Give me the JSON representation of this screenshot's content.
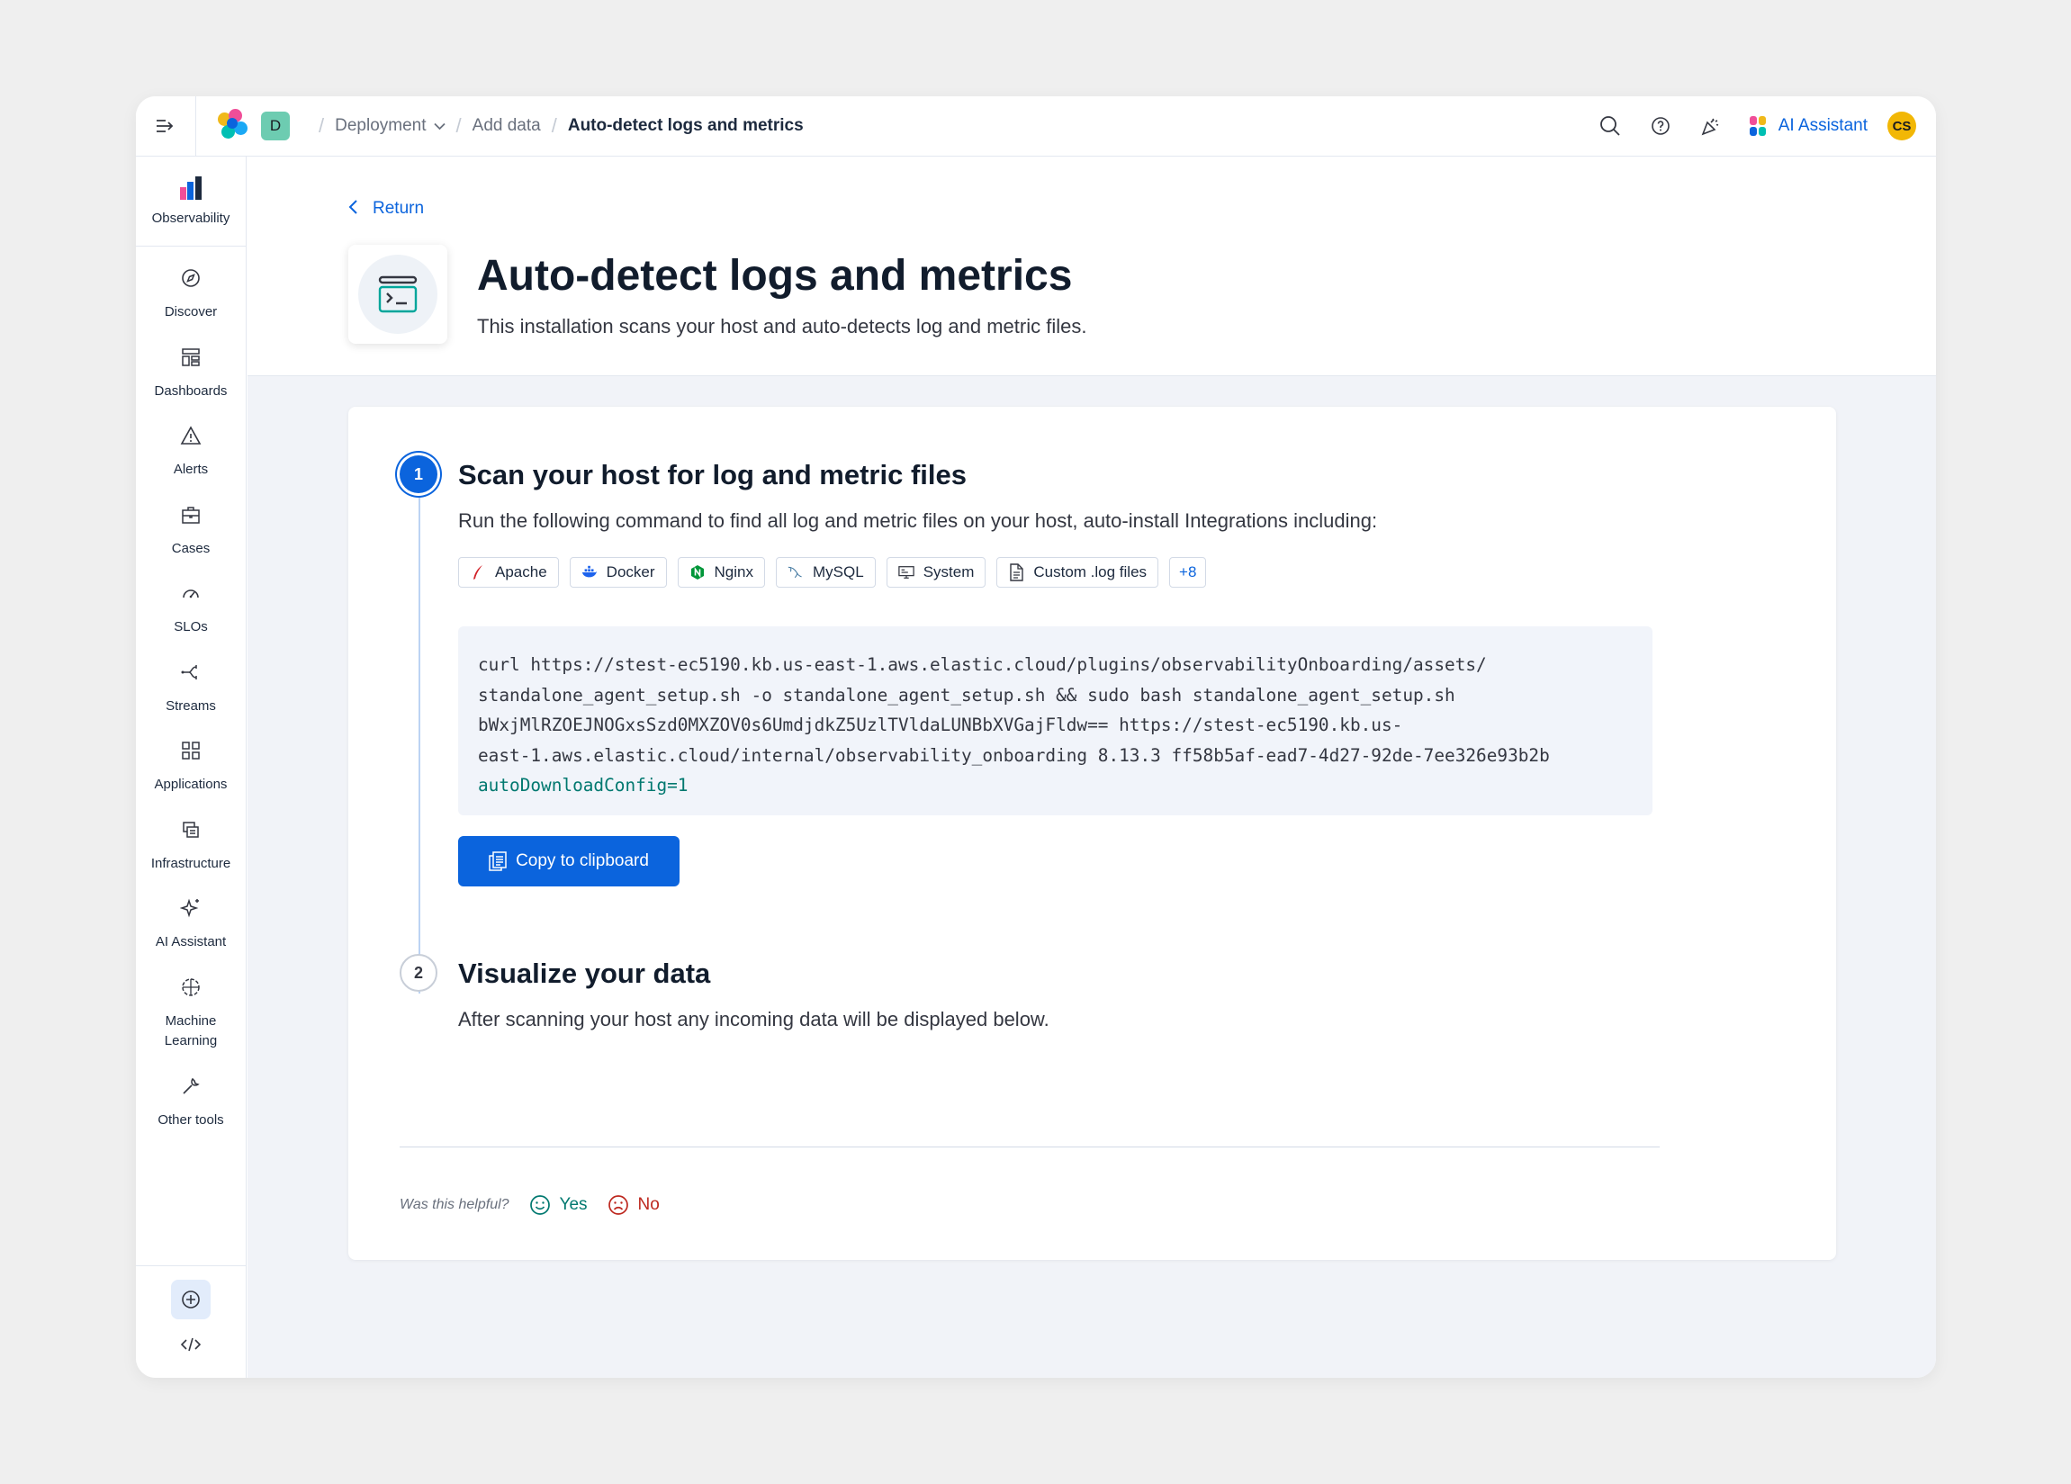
{
  "header": {
    "space_initial": "D",
    "breadcrumbs": [
      "Deployment",
      "Add data",
      "Auto-detect logs and metrics"
    ],
    "ai_assistant_label": "AI Assistant",
    "avatar_initials": "CS"
  },
  "sidebar": {
    "solution_label": "Observability",
    "items": [
      {
        "label": "Discover",
        "icon": "compass-icon"
      },
      {
        "label": "Dashboards",
        "icon": "dashboard-icon"
      },
      {
        "label": "Alerts",
        "icon": "warning-icon"
      },
      {
        "label": "Cases",
        "icon": "briefcase-icon"
      },
      {
        "label": "SLOs",
        "icon": "gauge-icon"
      },
      {
        "label": "Streams",
        "icon": "streams-icon"
      },
      {
        "label": "Applications",
        "icon": "apps-icon"
      },
      {
        "label": "Infrastructure",
        "icon": "infrastructure-icon"
      },
      {
        "label": "AI Assistant",
        "icon": "sparkles-icon"
      },
      {
        "label": "Machine Learning",
        "icon": "ml-icon"
      },
      {
        "label": "Other tools",
        "icon": "wrench-icon"
      }
    ]
  },
  "page": {
    "return_label": "Return",
    "title": "Auto-detect logs and metrics",
    "subtitle": "This installation scans your host and auto-detects log and metric files."
  },
  "step1": {
    "number": "1",
    "title": "Scan your host for log and metric files",
    "description": "Run the following command to find all log and metric files on your host, auto-install Integrations including:",
    "integrations": [
      "Apache",
      "Docker",
      "Nginx",
      "MySQL",
      "System",
      "Custom .log files"
    ],
    "more_count": "+8",
    "code_lines": [
      "curl https://stest-ec5190.kb.us-east-1.aws.elastic.cloud/plugins/observabilityOnboarding/assets/",
      "standalone_agent_setup.sh -o standalone_agent_setup.sh && sudo bash standalone_agent_setup.sh",
      "bWxjMlRZOEJNOGxsSzd0MXZOV0s6UmdjdkZ5UzlTVldaLUNBbXVGajFldw== https://stest-ec5190.kb.us-",
      "east-1.aws.elastic.cloud/internal/observability_onboarding 8.13.3 ff58b5af-ead7-4d27-92de-7ee326e93b2b"
    ],
    "code_highlight": "autoDownloadConfig=1",
    "copy_label": "Copy to clipboard"
  },
  "step2": {
    "number": "2",
    "title": "Visualize your data",
    "description": "After scanning your host any incoming data will be displayed below."
  },
  "feedback": {
    "question": "Was this helpful?",
    "yes": "Yes",
    "no": "No"
  },
  "colors": {
    "primary": "#0b64dd",
    "success": "#00786f",
    "danger": "#bd271e"
  }
}
